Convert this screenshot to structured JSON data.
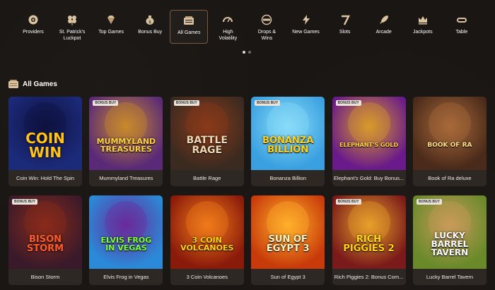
{
  "categories": [
    {
      "label": "Providers",
      "icon": "providers-icon",
      "active": false
    },
    {
      "label": "St. Patrick's\nLuckpot",
      "icon": "clover-icon",
      "active": false
    },
    {
      "label": "Top Games",
      "icon": "diamond-icon",
      "active": false
    },
    {
      "label": "Bonus Buy",
      "icon": "money-bag-icon",
      "active": false
    },
    {
      "label": "All Games",
      "icon": "all-games-icon",
      "active": true
    },
    {
      "label": "High\nVolatility",
      "icon": "gauge-icon",
      "active": false
    },
    {
      "label": "Drops &\nWins",
      "icon": "drops-wins-icon",
      "active": false
    },
    {
      "label": "New Games",
      "icon": "lightning-icon",
      "active": false
    },
    {
      "label": "Slots",
      "icon": "seven-icon",
      "active": false
    },
    {
      "label": "Arcade",
      "icon": "rocket-icon",
      "active": false
    },
    {
      "label": "Jackpots",
      "icon": "crown-icon",
      "active": false
    },
    {
      "label": "Table",
      "icon": "table-icon",
      "active": false
    }
  ],
  "section": {
    "title": "All Games"
  },
  "badge_text": "BONUS BUY",
  "games": [
    {
      "name": "Coin Win: Hold The Spin",
      "art_title": "COIN\nWIN",
      "bonus_buy": false,
      "bg": "#1c2a7a",
      "bg2": "#0e1240",
      "title_color": "#ffc21a",
      "size": 20
    },
    {
      "name": "Mummyland Treasures",
      "art_title": "MUMMYLAND\nTREASURES",
      "bonus_buy": true,
      "bg": "#5a2a78",
      "bg2": "#c88a2a",
      "title_color": "#ffd24a",
      "size": 11
    },
    {
      "name": "Battle Rage",
      "art_title": "BATTLE\nRAGE",
      "bonus_buy": true,
      "bg": "#3a2a20",
      "bg2": "#8a3a1a",
      "title_color": "#f0d8b0",
      "size": 14
    },
    {
      "name": "Bonanza Billion",
      "art_title": "BONANZA\nBILLION",
      "bonus_buy": true,
      "bg": "#3aa0e0",
      "bg2": "#8adcf8",
      "title_color": "#ffd21a",
      "size": 13
    },
    {
      "name": "Elephant's Gold: Buy Bonus...",
      "art_title": "ELEPHANT'S GOLD",
      "bonus_buy": true,
      "bg": "#6a1a8a",
      "bg2": "#d89a2a",
      "title_color": "#ffd24a",
      "size": 8
    },
    {
      "name": "Book of Ra deluxe",
      "art_title": "BOOK OF RA",
      "bonus_buy": false,
      "bg": "#4a2a1a",
      "bg2": "#a86a3a",
      "title_color": "#ffe08a",
      "size": 9
    },
    {
      "name": "Bison Storm",
      "art_title": "BISON\nSTORM",
      "bonus_buy": true,
      "bg": "#3a1a2a",
      "bg2": "#8a2a1a",
      "title_color": "#ff5a2a",
      "size": 13
    },
    {
      "name": "Elvis Frog in Vegas",
      "art_title": "ELVIS FROG\nIN VEGAS",
      "bonus_buy": false,
      "bg": "#2a8ad8",
      "bg2": "#6a2a9a",
      "title_color": "#7aff3a",
      "size": 11
    },
    {
      "name": "3 Coin Volcanoes",
      "art_title": "3 COIN\nVOLCANOES",
      "bonus_buy": false,
      "bg": "#8a1a0a",
      "bg2": "#f07a1a",
      "title_color": "#ffd21a",
      "size": 11
    },
    {
      "name": "Sun of Egypt 3",
      "art_title": "SUN OF\nEGYPT 3",
      "bonus_buy": false,
      "bg": "#c83a0a",
      "bg2": "#ffb02a",
      "title_color": "#fff2c0",
      "size": 13
    },
    {
      "name": "Rich Piggies 2: Bonus Com...",
      "art_title": "RICH\nPIGGIES 2",
      "bonus_buy": true,
      "bg": "#7a1a1a",
      "bg2": "#e8a02a",
      "title_color": "#ffd21a",
      "size": 13
    },
    {
      "name": "Lucky Barrel Tavern",
      "art_title": "LUCKY\nBARREL\nTAVERN",
      "bonus_buy": true,
      "bg": "#6a8a2a",
      "bg2": "#c89a5a",
      "title_color": "#ffffff",
      "size": 12
    }
  ],
  "colors": {
    "background": "#1a1613",
    "card": "#2e2824",
    "badge": "#e9e3dc",
    "active_border": "#7a5a40"
  }
}
